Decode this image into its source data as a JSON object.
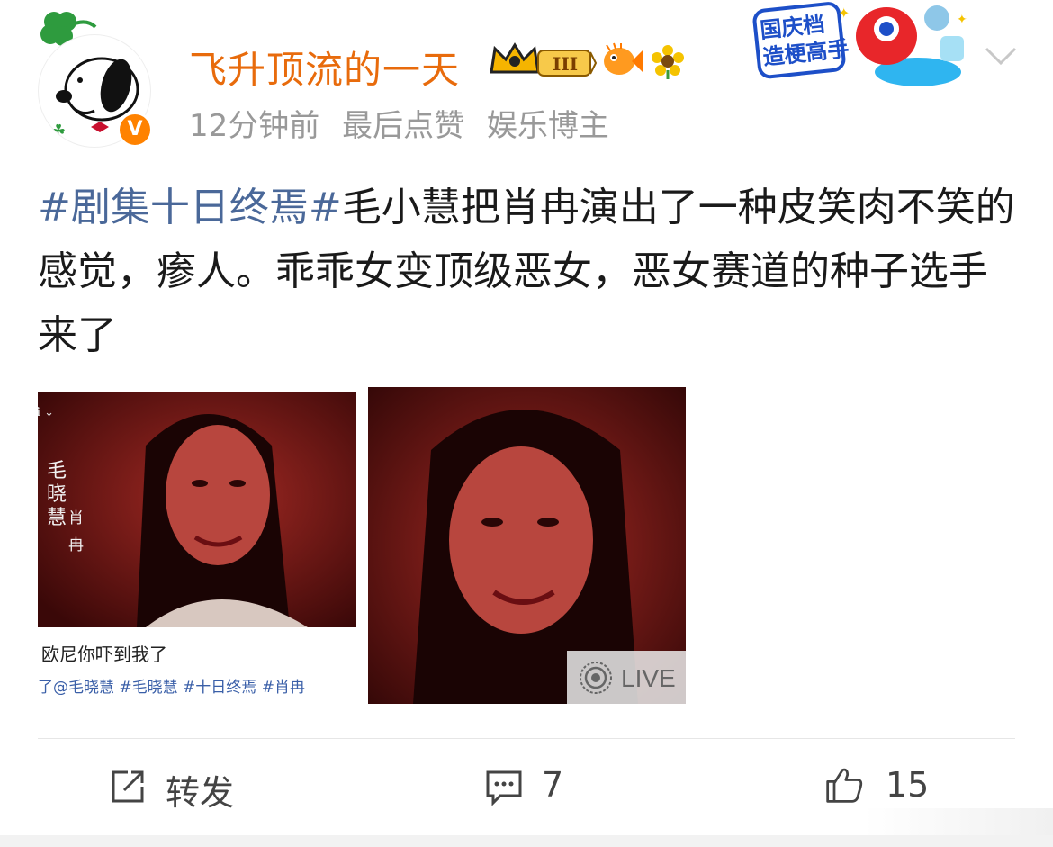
{
  "header": {
    "username": "飞升顶流的一天",
    "level_badge": "III",
    "time": "12分钟前",
    "activity": "最后点赞",
    "category": "娱乐博主",
    "verified_badge": "V",
    "promo_line1": "国庆档",
    "promo_line2": "造梗高手"
  },
  "post": {
    "hashtag": "#剧集十日终焉#",
    "text": "毛小慧把肖冉演出了一种皮笑肉不笑的感觉，瘆人。乖乖女变顶级恶女，恶女赛道的种子选手来了"
  },
  "images": {
    "img1_corner": "ℹ ⌄",
    "img1_vertical_name": "毛晓慧",
    "img1_vertical_role": "肖冉",
    "img1_caption": "欧尼你吓到我了",
    "img1_tags": "了@毛晓慧 #毛晓慧 #十日终焉 #肖冉",
    "live_label": "LIVE"
  },
  "actions": {
    "repost_label": "转发",
    "comment_count": "7",
    "like_count": "15"
  },
  "colors": {
    "username": "#e86b0c",
    "hashtag": "#4a6899",
    "meta": "#999999",
    "photo_bg": "#7a1414"
  },
  "icons": [
    "clover-icon",
    "verified-icon",
    "crown-badge-icon",
    "fish-icon",
    "sunflower-icon",
    "chevron-down-icon",
    "live-icon",
    "repost-icon",
    "comment-icon",
    "like-icon"
  ]
}
